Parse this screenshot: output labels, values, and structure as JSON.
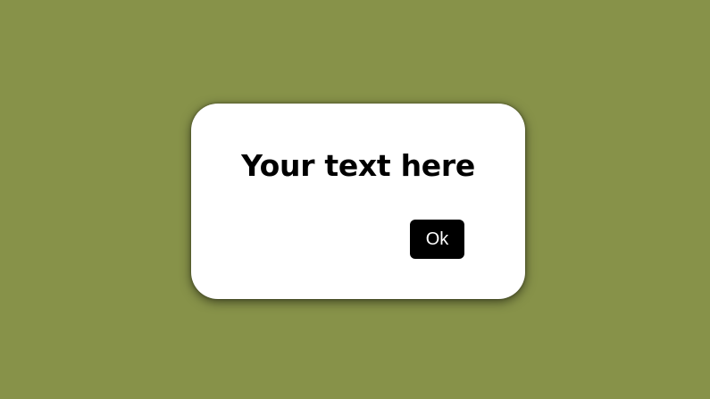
{
  "dialog": {
    "title": "Your text here",
    "ok_label": "Ok"
  },
  "colors": {
    "background": "#879249",
    "dialog_background": "#ffffff",
    "button_background": "#000000",
    "button_text": "#ffffff"
  }
}
